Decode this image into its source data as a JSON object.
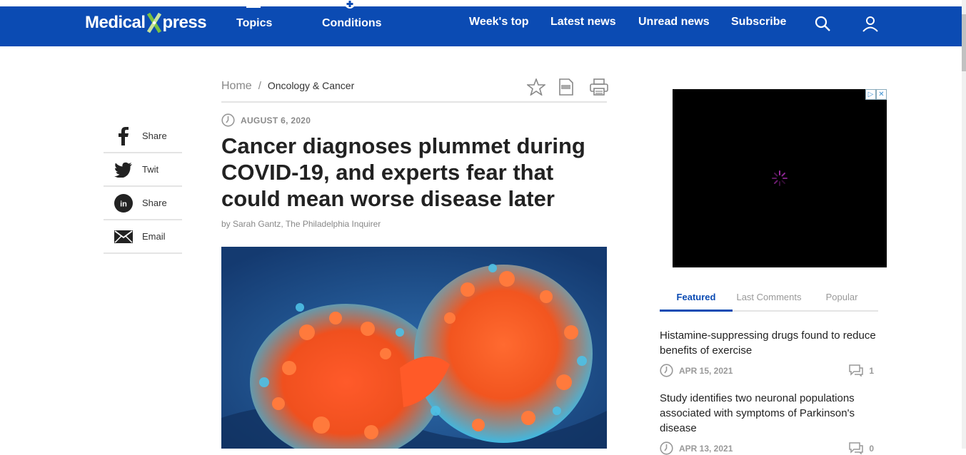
{
  "header": {
    "logo_left": "Medical",
    "logo_right": "press",
    "topics_label": "Topics",
    "conditions_label": "Conditions",
    "links": [
      "Week's top",
      "Latest news",
      "Unread news",
      "Subscribe"
    ],
    "brand_color": "#0b4bb3"
  },
  "share": [
    {
      "icon": "facebook-icon",
      "label": "Share"
    },
    {
      "icon": "twitter-icon",
      "label": "Twit"
    },
    {
      "icon": "linkedin-icon",
      "label": "Share"
    },
    {
      "icon": "email-icon",
      "label": "Email"
    }
  ],
  "breadcrumb": {
    "home": "Home",
    "separator": "/",
    "current": "Oncology & Cancer"
  },
  "article": {
    "date": "AUGUST 6, 2020",
    "title": "Cancer diagnoses plummet during COVID-19, and experts fear that could mean worse disease later",
    "byline": "by Sarah Gantz, The Philadelphia Inquirer"
  },
  "sidebar": {
    "tabs": [
      "Featured",
      "Last Comments",
      "Popular"
    ],
    "active_tab": "Featured",
    "items": [
      {
        "headline": "Histamine-suppressing drugs found to reduce benefits of exercise",
        "date": "APR 15, 2021",
        "comments": "1"
      },
      {
        "headline": "Study identifies two neuronal populations associated with symptoms of Parkinson's disease",
        "date": "APR 13, 2021",
        "comments": "0"
      }
    ]
  }
}
